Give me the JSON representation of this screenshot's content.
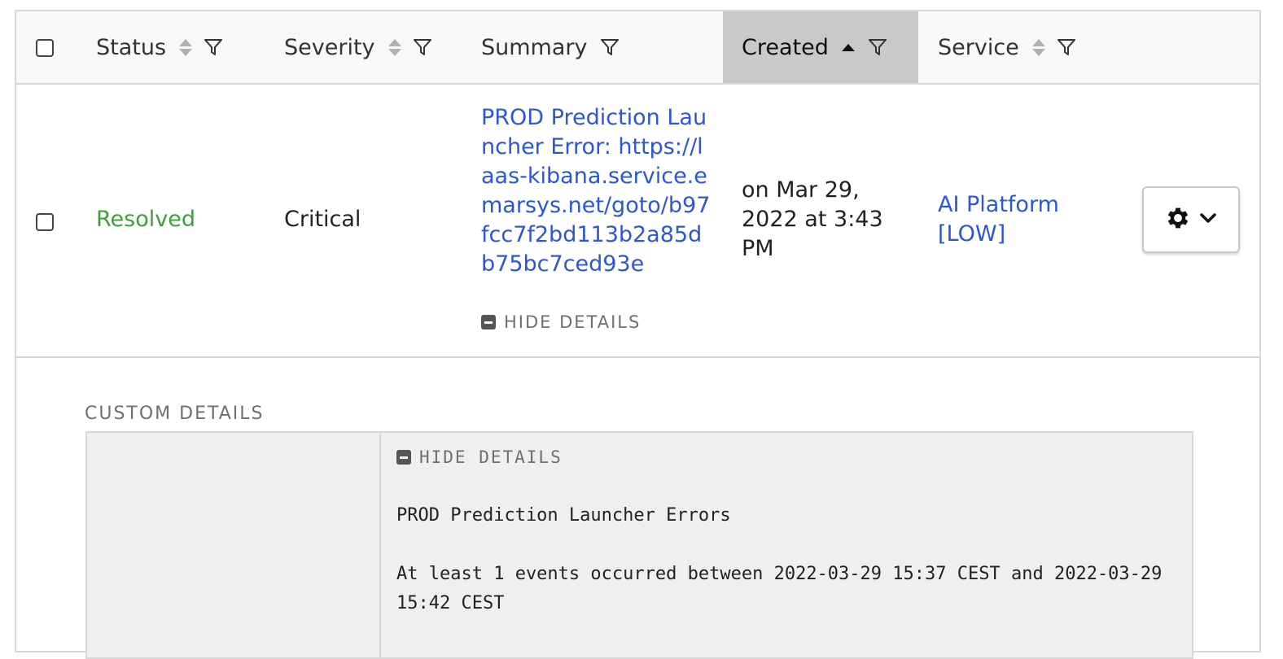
{
  "header": {
    "columns": [
      {
        "label": "Status"
      },
      {
        "label": "Severity"
      },
      {
        "label": "Summary"
      },
      {
        "label": "Created"
      },
      {
        "label": "Service"
      }
    ]
  },
  "row": {
    "status": "Resolved",
    "severity": "Critical",
    "summary": "PROD Prediction Launcher Error: https://laas-kibana.service.emarsys.net/goto/b97fcc7f2bd113b2a85db75bc7ced93e",
    "hide_details": "HIDE DETAILS",
    "created": "on Mar 29, 2022 at 3:43 PM",
    "service": "AI Platform [LOW]"
  },
  "details": {
    "section_label": "CUSTOM DETAILS",
    "hide_details": "HIDE DETAILS",
    "title": "PROD Prediction Launcher Errors",
    "body": "At least 1 events occurred between 2022-03-29 15:37 CEST and 2022-03-29 15:42 CEST"
  },
  "colors": {
    "resolved": "#3aa335",
    "link": "#2a57d6",
    "sorted_header": "#c9c9c9"
  },
  "icons": [
    "sort-icon",
    "filter-icon",
    "sort-ascending-icon",
    "gear-icon",
    "chevron-down-icon",
    "collapse-icon"
  ]
}
